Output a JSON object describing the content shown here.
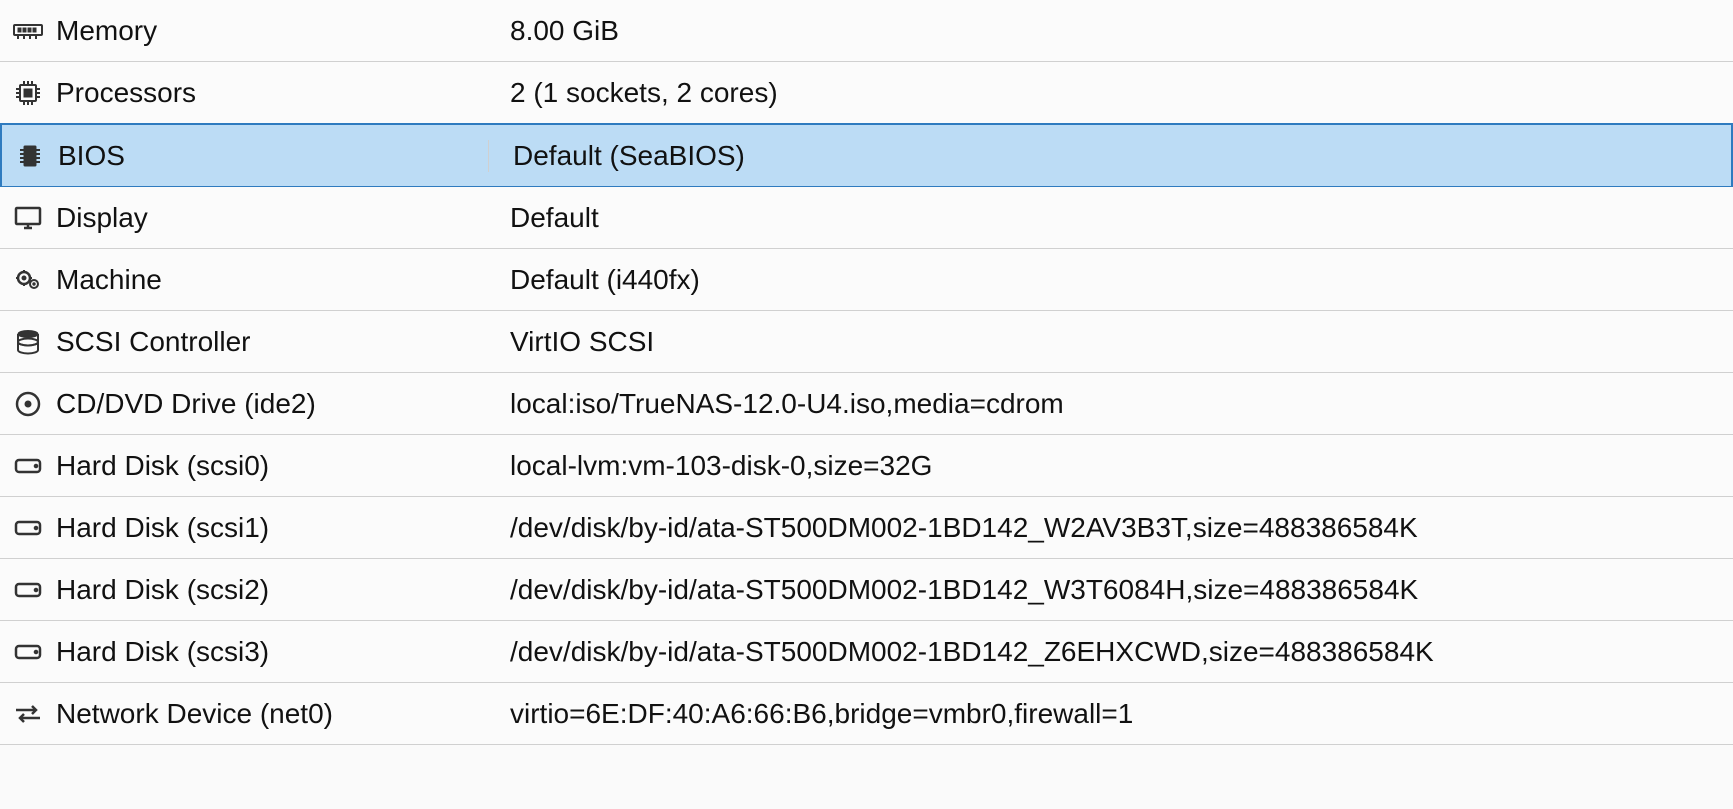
{
  "rows": [
    {
      "icon": "memory",
      "label": "Memory",
      "value": "8.00 GiB",
      "selected": false
    },
    {
      "icon": "cpu",
      "label": "Processors",
      "value": "2 (1 sockets, 2 cores)",
      "selected": false
    },
    {
      "icon": "chip",
      "label": "BIOS",
      "value": "Default (SeaBIOS)",
      "selected": true
    },
    {
      "icon": "display",
      "label": "Display",
      "value": "Default",
      "selected": false
    },
    {
      "icon": "cogs",
      "label": "Machine",
      "value": "Default (i440fx)",
      "selected": false
    },
    {
      "icon": "database",
      "label": "SCSI Controller",
      "value": "VirtIO SCSI",
      "selected": false
    },
    {
      "icon": "disc",
      "label": "CD/DVD Drive (ide2)",
      "value": "local:iso/TrueNAS-12.0-U4.iso,media=cdrom",
      "selected": false
    },
    {
      "icon": "hdd",
      "label": "Hard Disk (scsi0)",
      "value": "local-lvm:vm-103-disk-0,size=32G",
      "selected": false
    },
    {
      "icon": "hdd",
      "label": "Hard Disk (scsi1)",
      "value": "/dev/disk/by-id/ata-ST500DM002-1BD142_W2AV3B3T,size=488386584K",
      "selected": false
    },
    {
      "icon": "hdd",
      "label": "Hard Disk (scsi2)",
      "value": "/dev/disk/by-id/ata-ST500DM002-1BD142_W3T6084H,size=488386584K",
      "selected": false
    },
    {
      "icon": "hdd",
      "label": "Hard Disk (scsi3)",
      "value": "/dev/disk/by-id/ata-ST500DM002-1BD142_Z6EHXCWD,size=488386584K",
      "selected": false
    },
    {
      "icon": "network",
      "label": "Network Device (net0)",
      "value": "virtio=6E:DF:40:A6:66:B6,bridge=vmbr0,firewall=1",
      "selected": false
    }
  ]
}
